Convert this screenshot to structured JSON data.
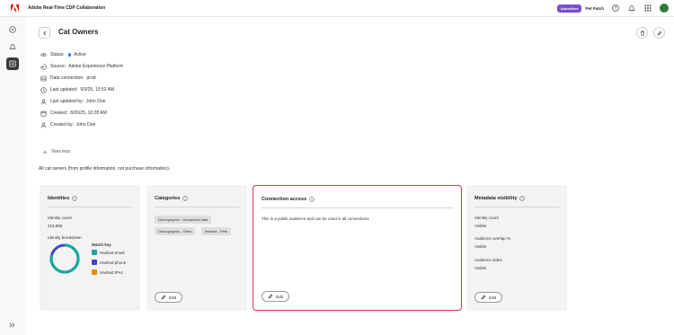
{
  "app": {
    "title": "Adobe Real-Time CDP Collaboration",
    "badge": "Advertiser",
    "org": "Pet Patch",
    "icons": [
      "adobe-logo-icon",
      "help-icon",
      "bell-icon",
      "apps-grid-icon",
      "avatar"
    ],
    "accent": "#7c4dcc"
  },
  "rail": {
    "items": [
      "compass-icon",
      "bell-icon",
      "audience-icon"
    ],
    "active_index": 2,
    "expand_icon": "double-chevron-right-icon"
  },
  "page": {
    "title": "Cat Owners",
    "actions": [
      "delete-icon",
      "edit-pencil-icon"
    ]
  },
  "details": [
    {
      "label": "Status:",
      "value": "Active",
      "icon": "status-icon",
      "status_color": "#2680eb"
    },
    {
      "label": "Source:",
      "value": "Adobe Experience Platform",
      "icon": "source-icon"
    },
    {
      "label": "Data connection:",
      "value": "prod",
      "icon": "database-icon"
    },
    {
      "label": "Last updated:",
      "value": "9/3/25, 10:52 AM",
      "icon": "clock-icon"
    },
    {
      "label": "Last updated by:",
      "value": "John Doe",
      "icon": "user-icon"
    },
    {
      "label": "Created:",
      "value": "8/26/25, 10:28 AM",
      "icon": "calendar-icon"
    },
    {
      "label": "Created by:",
      "value": "John Doe",
      "icon": "user-icon"
    }
  ],
  "view_less": "View less",
  "description": "All cat owners (from profile information, not purchase information).",
  "cards": {
    "identities": {
      "title": "Identities",
      "count_label": "Identity count",
      "count_value": "219,886",
      "breakdown_label": "Identity breakdown",
      "legend_title": "Match key",
      "legend": [
        {
          "label": "Hashed email",
          "color": "#15a89a"
        },
        {
          "label": "Hashed phone",
          "color": "#4046ca"
        },
        {
          "label": "Hashed IPv4",
          "color": "#f68511"
        }
      ]
    },
    "categories": {
      "title": "Categories",
      "tags": [
        "Demographic - Household data",
        "Demographic - Other",
        "Interest - Pets"
      ],
      "edit": "Edit"
    },
    "connection": {
      "title": "Connection access",
      "text": "This is a public audience and can be used in all connections",
      "edit": "Edit",
      "highlight_color": "#d7373f"
    },
    "metadata": {
      "title": "Metadata visibility",
      "rows": [
        {
          "label": "Identity count",
          "value": "Visible"
        },
        {
          "label": "Audience overlap %",
          "value": "Visible"
        },
        {
          "label": "Audience index",
          "value": "Visible"
        }
      ],
      "edit": "Edit"
    }
  }
}
